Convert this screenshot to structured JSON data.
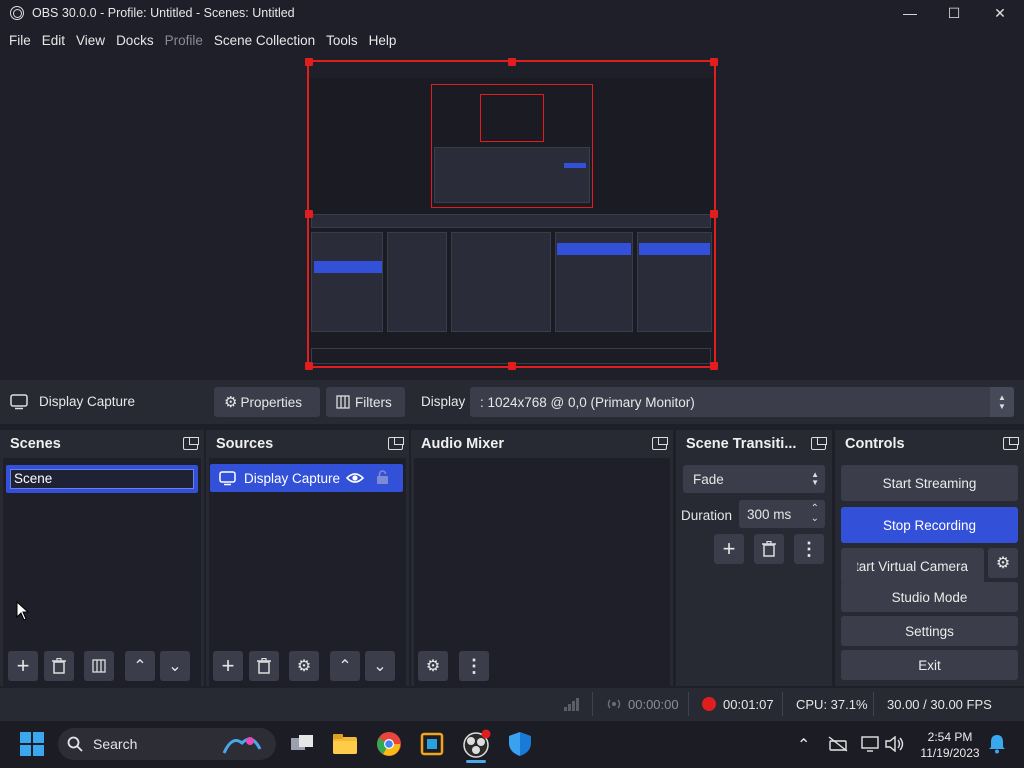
{
  "window": {
    "title": "OBS 30.0.0 - Profile: Untitled - Scenes: Untitled",
    "minimize": "—",
    "maximize": "☐",
    "close": "✕"
  },
  "menu": {
    "items": [
      {
        "label": "File",
        "disabled": false
      },
      {
        "label": "Edit",
        "disabled": false
      },
      {
        "label": "View",
        "disabled": false
      },
      {
        "label": "Docks",
        "disabled": false
      },
      {
        "label": "Profile",
        "disabled": true
      },
      {
        "label": "Scene Collection",
        "disabled": false
      },
      {
        "label": "Tools",
        "disabled": false
      },
      {
        "label": "Help",
        "disabled": false
      }
    ]
  },
  "source_toolbar": {
    "source_name": "Display Capture",
    "properties_label": "Properties",
    "filters_label": "Filters",
    "display_label": "Display",
    "display_value": ": 1024x768 @ 0,0 (Primary Monitor)"
  },
  "docks": {
    "scenes": {
      "title": "Scenes",
      "items": [
        "Scene"
      ]
    },
    "sources": {
      "title": "Sources",
      "items": [
        "Display Capture"
      ]
    },
    "audio_mixer": {
      "title": "Audio Mixer"
    },
    "transitions": {
      "title": "Scene Transiti...",
      "transition": "Fade",
      "duration_label": "Duration",
      "duration_value": "300 ms"
    },
    "controls": {
      "title": "Controls",
      "start_streaming": "Start Streaming",
      "stop_recording": "Stop Recording",
      "virtual_camera": "Start Virtual Camera",
      "studio_mode": "Studio Mode",
      "settings": "Settings",
      "exit": "Exit"
    }
  },
  "status": {
    "stream_time": "00:00:00",
    "record_time": "00:01:07",
    "cpu": "CPU: 37.1%",
    "fps": "30.00 / 30.00 FPS"
  },
  "taskbar": {
    "search_label": "Search",
    "time": "2:54 PM",
    "date": "11/19/2023"
  },
  "colors": {
    "accent": "#3250d8",
    "preview_border": "#e01e1e",
    "panel": "#272a33",
    "background": "#1e1f29"
  }
}
